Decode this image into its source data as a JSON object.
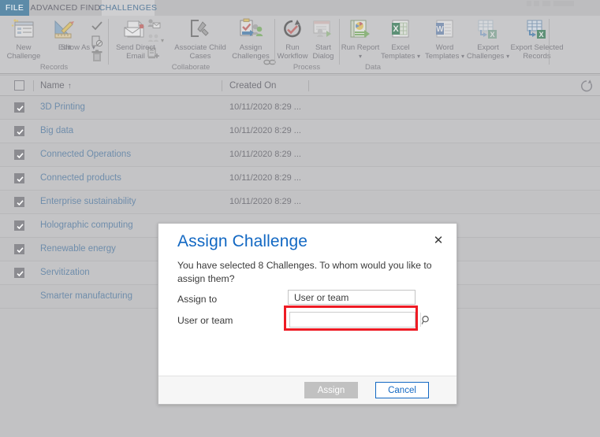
{
  "tabs": [
    {
      "label": "FILE",
      "id": "file"
    },
    {
      "label": "ADVANCED FIND",
      "id": "advanced-find"
    },
    {
      "label": "CHALLENGES",
      "id": "challenges"
    }
  ],
  "ribbon": {
    "groups": [
      {
        "name": "Records",
        "label": "Records",
        "buttons": [
          {
            "label": "New Challenge",
            "icon": "new-record-icon"
          },
          {
            "label": "Edit",
            "icon": "edit-pencil-ruler-icon"
          },
          {
            "label": "Show As",
            "icon": "show-as-icon",
            "dropdown": true
          }
        ],
        "small_buttons": [
          {
            "name": "activate-check-icon"
          },
          {
            "name": "deactivate-document-icon"
          },
          {
            "name": "delete-trash-icon"
          }
        ]
      },
      {
        "name": "Collaborate",
        "label": "Collaborate",
        "buttons": [
          {
            "label": "Send Direct Email",
            "icon": "send-direct-email-icon"
          },
          {
            "label": "Associate Child Cases",
            "icon": "associate-child-cases-icon"
          },
          {
            "label": "Assign Challenges",
            "icon": "assign-challenges-icon"
          }
        ],
        "small_buttons": [
          {
            "name": "add-connection-icon"
          },
          {
            "name": "connect-to-other-icon"
          },
          {
            "name": "add-to-queue-icon"
          },
          {
            "name": "link-icon"
          }
        ]
      },
      {
        "name": "Process",
        "label": "Process",
        "buttons": [
          {
            "label": "Run Workflow",
            "icon": "run-workflow-icon"
          },
          {
            "label": "Start Dialog",
            "icon": "start-dialog-icon"
          }
        ],
        "small_buttons": [
          {
            "name": "refresh-process-icon"
          },
          {
            "name": "page-icon"
          }
        ]
      },
      {
        "name": "Data",
        "label": "Data",
        "buttons": [
          {
            "label": "Run Report",
            "icon": "run-report-icon",
            "dropdown": true
          },
          {
            "label": "Excel Templates",
            "icon": "excel-templates-icon",
            "dropdown": true
          },
          {
            "label": "Word Templates",
            "icon": "word-templates-icon",
            "dropdown": true
          },
          {
            "label": "Export Challenges",
            "icon": "export-challenges-icon",
            "dropdown": true
          },
          {
            "label": "Export Selected Records",
            "icon": "export-selected-records-icon"
          }
        ]
      }
    ]
  },
  "grid": {
    "columns": [
      {
        "label": "Name",
        "sort": "↑"
      },
      {
        "label": "Created On",
        "sort": ""
      }
    ],
    "refresh_icon": "refresh-icon",
    "rows": [
      {
        "name": "3D Printing",
        "created_on": "10/11/2020 8:29 ...",
        "checked": true
      },
      {
        "name": "Big data",
        "created_on": "10/11/2020 8:29 ...",
        "checked": true
      },
      {
        "name": "Connected Operations",
        "created_on": "10/11/2020 8:29 ...",
        "checked": true
      },
      {
        "name": "Connected products",
        "created_on": "10/11/2020 8:29 ...",
        "checked": true
      },
      {
        "name": "Enterprise sustainability",
        "created_on": "10/11/2020 8:29 ...",
        "checked": true
      },
      {
        "name": "Holographic computing",
        "created_on": "",
        "checked": true
      },
      {
        "name": "Renewable energy",
        "created_on": "",
        "checked": true
      },
      {
        "name": "Servitization",
        "created_on": "",
        "checked": true
      },
      {
        "name": "Smarter manufacturing",
        "created_on": "",
        "checked": false
      }
    ]
  },
  "dialog": {
    "title": "Assign Challenge",
    "close_label": "✕",
    "description": "You have selected 8 Challenges. To whom would you like to assign them?",
    "assign_to_label": "Assign to",
    "assign_to_value": "User or team",
    "user_or_team_label": "User or team",
    "user_or_team_value": "",
    "user_or_team_placeholder": "",
    "lookup_icon": "search-icon",
    "assign_button": "Assign",
    "cancel_button": "Cancel",
    "highlight_color": "#ee1b24",
    "accent_color": "#1268c3"
  }
}
